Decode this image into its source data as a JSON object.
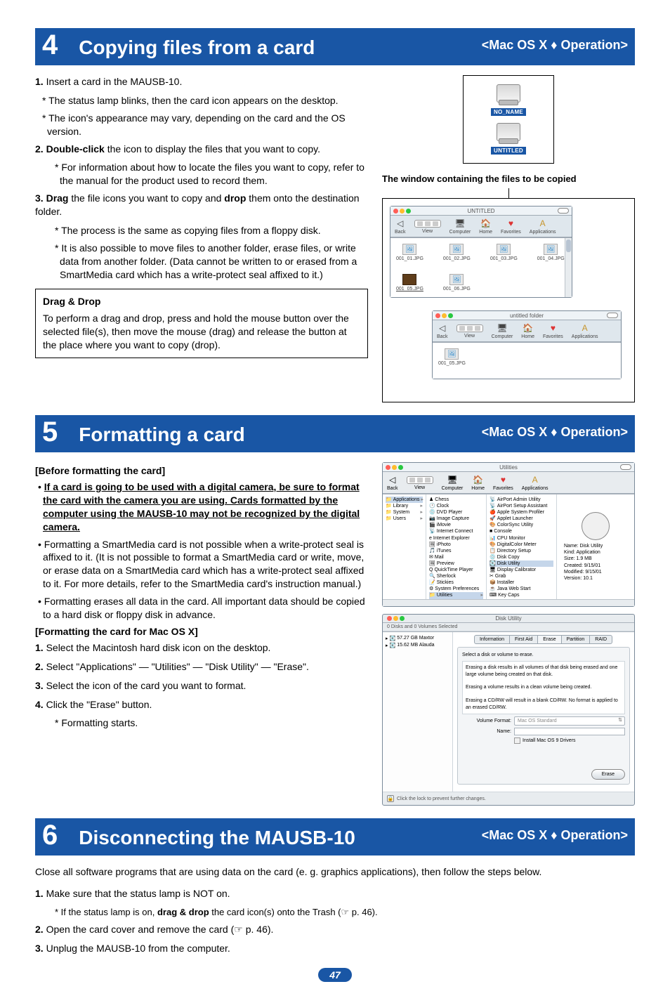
{
  "sections": {
    "s4": {
      "num": "4",
      "title": "Copying files from a card",
      "tag": "<Mac OS X ♦ Operation>"
    },
    "s5": {
      "num": "5",
      "title": "Formatting a card",
      "tag": "<Mac OS X ♦ Operation>"
    },
    "s6": {
      "num": "6",
      "title": "Disconnecting the MAUSB-10",
      "tag": "<Mac OS X ♦ Operation>"
    }
  },
  "s4": {
    "step1_num": "1.",
    "step1": " Insert a card in the MAUSB-10.",
    "note1": "* The status lamp blinks, then the card icon appears on the desktop.",
    "note2": "* The icon's appearance may vary, depending on the card and the OS version.",
    "step2_num": "2.",
    "step2_bold": " Double-click",
    "step2_rest": " the icon to display the files that you want to copy.",
    "note3": "* For information about how to locate the files you want to copy, refer to the manual for the product used to record them.",
    "step3_num": "3.",
    "step3_bold1": " Drag",
    "step3_mid": " the file icons you want to copy and ",
    "step3_bold2": "drop",
    "step3_rest": " them onto the destination folder.",
    "note4": "* The process is the same as copying files from a floppy disk.",
    "note5": "* It is also possible to move files to another folder, erase files, or write data from another folder. (Data cannot be written to or erased from a SmartMedia card which has a write-protect seal affixed to it.)",
    "box_title": "Drag & Drop",
    "box_body": "To perform a drag and drop, press and hold the mouse button over the selected file(s), then move the mouse (drag) and release the button at the place where you want to copy (drop).",
    "drive1": "NO_NAME",
    "drive2": "UNTITLED",
    "caption": "The window containing the files to be copied",
    "window1_title": "UNTITLED",
    "window2_title": "untitled folder",
    "tb_back": "Back",
    "tb_view": "View",
    "tb_computer": "Computer",
    "tb_home": "Home",
    "tb_favorites": "Favorites",
    "tb_applications": "Applications",
    "files": {
      "f1": "001_01.JPG",
      "f2": "001_02.JPG",
      "f3": "001_03.JPG",
      "f4": "001_04.JPG",
      "f5": "001_05.JPG",
      "f6": "001_06.JPG",
      "dest": "001_05.JPG"
    }
  },
  "s5": {
    "before_heading": "[Before formatting the card]",
    "warn": "If a card is going to be used with a digital camera, be sure to format the card with the camera you are using. Cards formatted by the computer using the MAUSB-10 may not be recognized by the digital camera.",
    "bullet2": "Formatting a SmartMedia card is not possible when a write-protect seal is affixed to it. (It is not possible to format a SmartMedia card or write, move, or erase data on a SmartMedia card which has a write-protect seal affixed to it. For more details, refer to the SmartMedia card's instruction manual.)",
    "bullet3": "Formatting erases all data in the card. All important data should be copied to a hard disk or floppy disk in advance.",
    "fmt_heading": "[Formatting the card for Mac OS X]",
    "step1_num": "1.",
    "step1": " Select the Macintosh hard disk icon on the desktop.",
    "step2_num": "2.",
    "step2": " Select \"Applications\" — \"Utilities\" — \"Disk Utility\" — \"Erase\".",
    "step3_num": "3.",
    "step3": " Select the icon of the card you want to format.",
    "step4_num": "4.",
    "step4": " Click the \"Erase\" button.",
    "note": "* Formatting starts.",
    "utilities_title": "Utilities",
    "finder_col1": [
      "Applications",
      "Library",
      "System",
      "Users"
    ],
    "finder_col2": [
      "Chess",
      "Clock",
      "DVD Player",
      "Image Capture",
      "iMovie",
      "Internet Connect",
      "Internet Explorer",
      "iPhoto",
      "iTunes",
      "Mail",
      "Preview",
      "QuickTime Player",
      "Sherlock",
      "Stickies",
      "System Preferences",
      "Utilities"
    ],
    "finder_col3": [
      "AirPort Admin Utility",
      "AirPort Setup Assistant",
      "Apple System Profiler",
      "Applet Launcher",
      "ColorSync Utility",
      "Console",
      "CPU Monitor",
      "DigitalColor Meter",
      "Directory Setup",
      "Disk Copy",
      "Disk Utility",
      "Display Calibrator",
      "Grab",
      "Installer",
      "Java Web Start",
      "Key Caps"
    ],
    "preview": {
      "name": "Name: Disk Utility",
      "kind": "Kind: Application",
      "size": "Size: 1.9 MB",
      "created": "Created: 9/15/01",
      "modified": "Modified: 9/15/01",
      "version": "Version: 10.1"
    },
    "du_title": "Disk Utility",
    "du_subtitle": "0 Disks and 0 Volumes Selected",
    "du_sidebar": [
      "57.27 GB Maxtor",
      "15.62 MB Alauda"
    ],
    "du_tabs": [
      "Information",
      "First Aid",
      "Erase",
      "Partition",
      "RAID"
    ],
    "du_instruction": "Select a disk or volume to erase.",
    "du_note1": "Erasing a disk results in all volumes of that disk being erased and one large volume being created on that disk.",
    "du_note2": "Erasing a volume results in a clean volume being created.",
    "du_note3": "Erasing a CD/RW will result in a blank CD/RW.  No format is applied to an erased CD/RW.",
    "du_volfmt_label": "Volume Format:",
    "du_volfmt_value": "Mac OS Standard",
    "du_name_label": "Name:",
    "du_install_drivers": "Install Mac OS 9 Drivers",
    "du_erase_btn": "Erase",
    "du_lock": "Click the lock to prevent further changes."
  },
  "s6": {
    "intro": "Close all software programs that are using data on the card (e. g. graphics applications), then follow the steps below.",
    "step1_num": "1.",
    "step1": " Make sure that the status lamp is NOT on.",
    "note1a": "* If the status lamp is on, ",
    "note1b": "drag & drop",
    "note1c": " the card icon(s) onto the Trash (☞ p. 46).",
    "step2_num": "2.",
    "step2": " Open the card cover and remove the card (☞ p. 46).",
    "step3_num": "3.",
    "step3": " Unplug the MAUSB-10 from the computer."
  },
  "page_number": "47"
}
